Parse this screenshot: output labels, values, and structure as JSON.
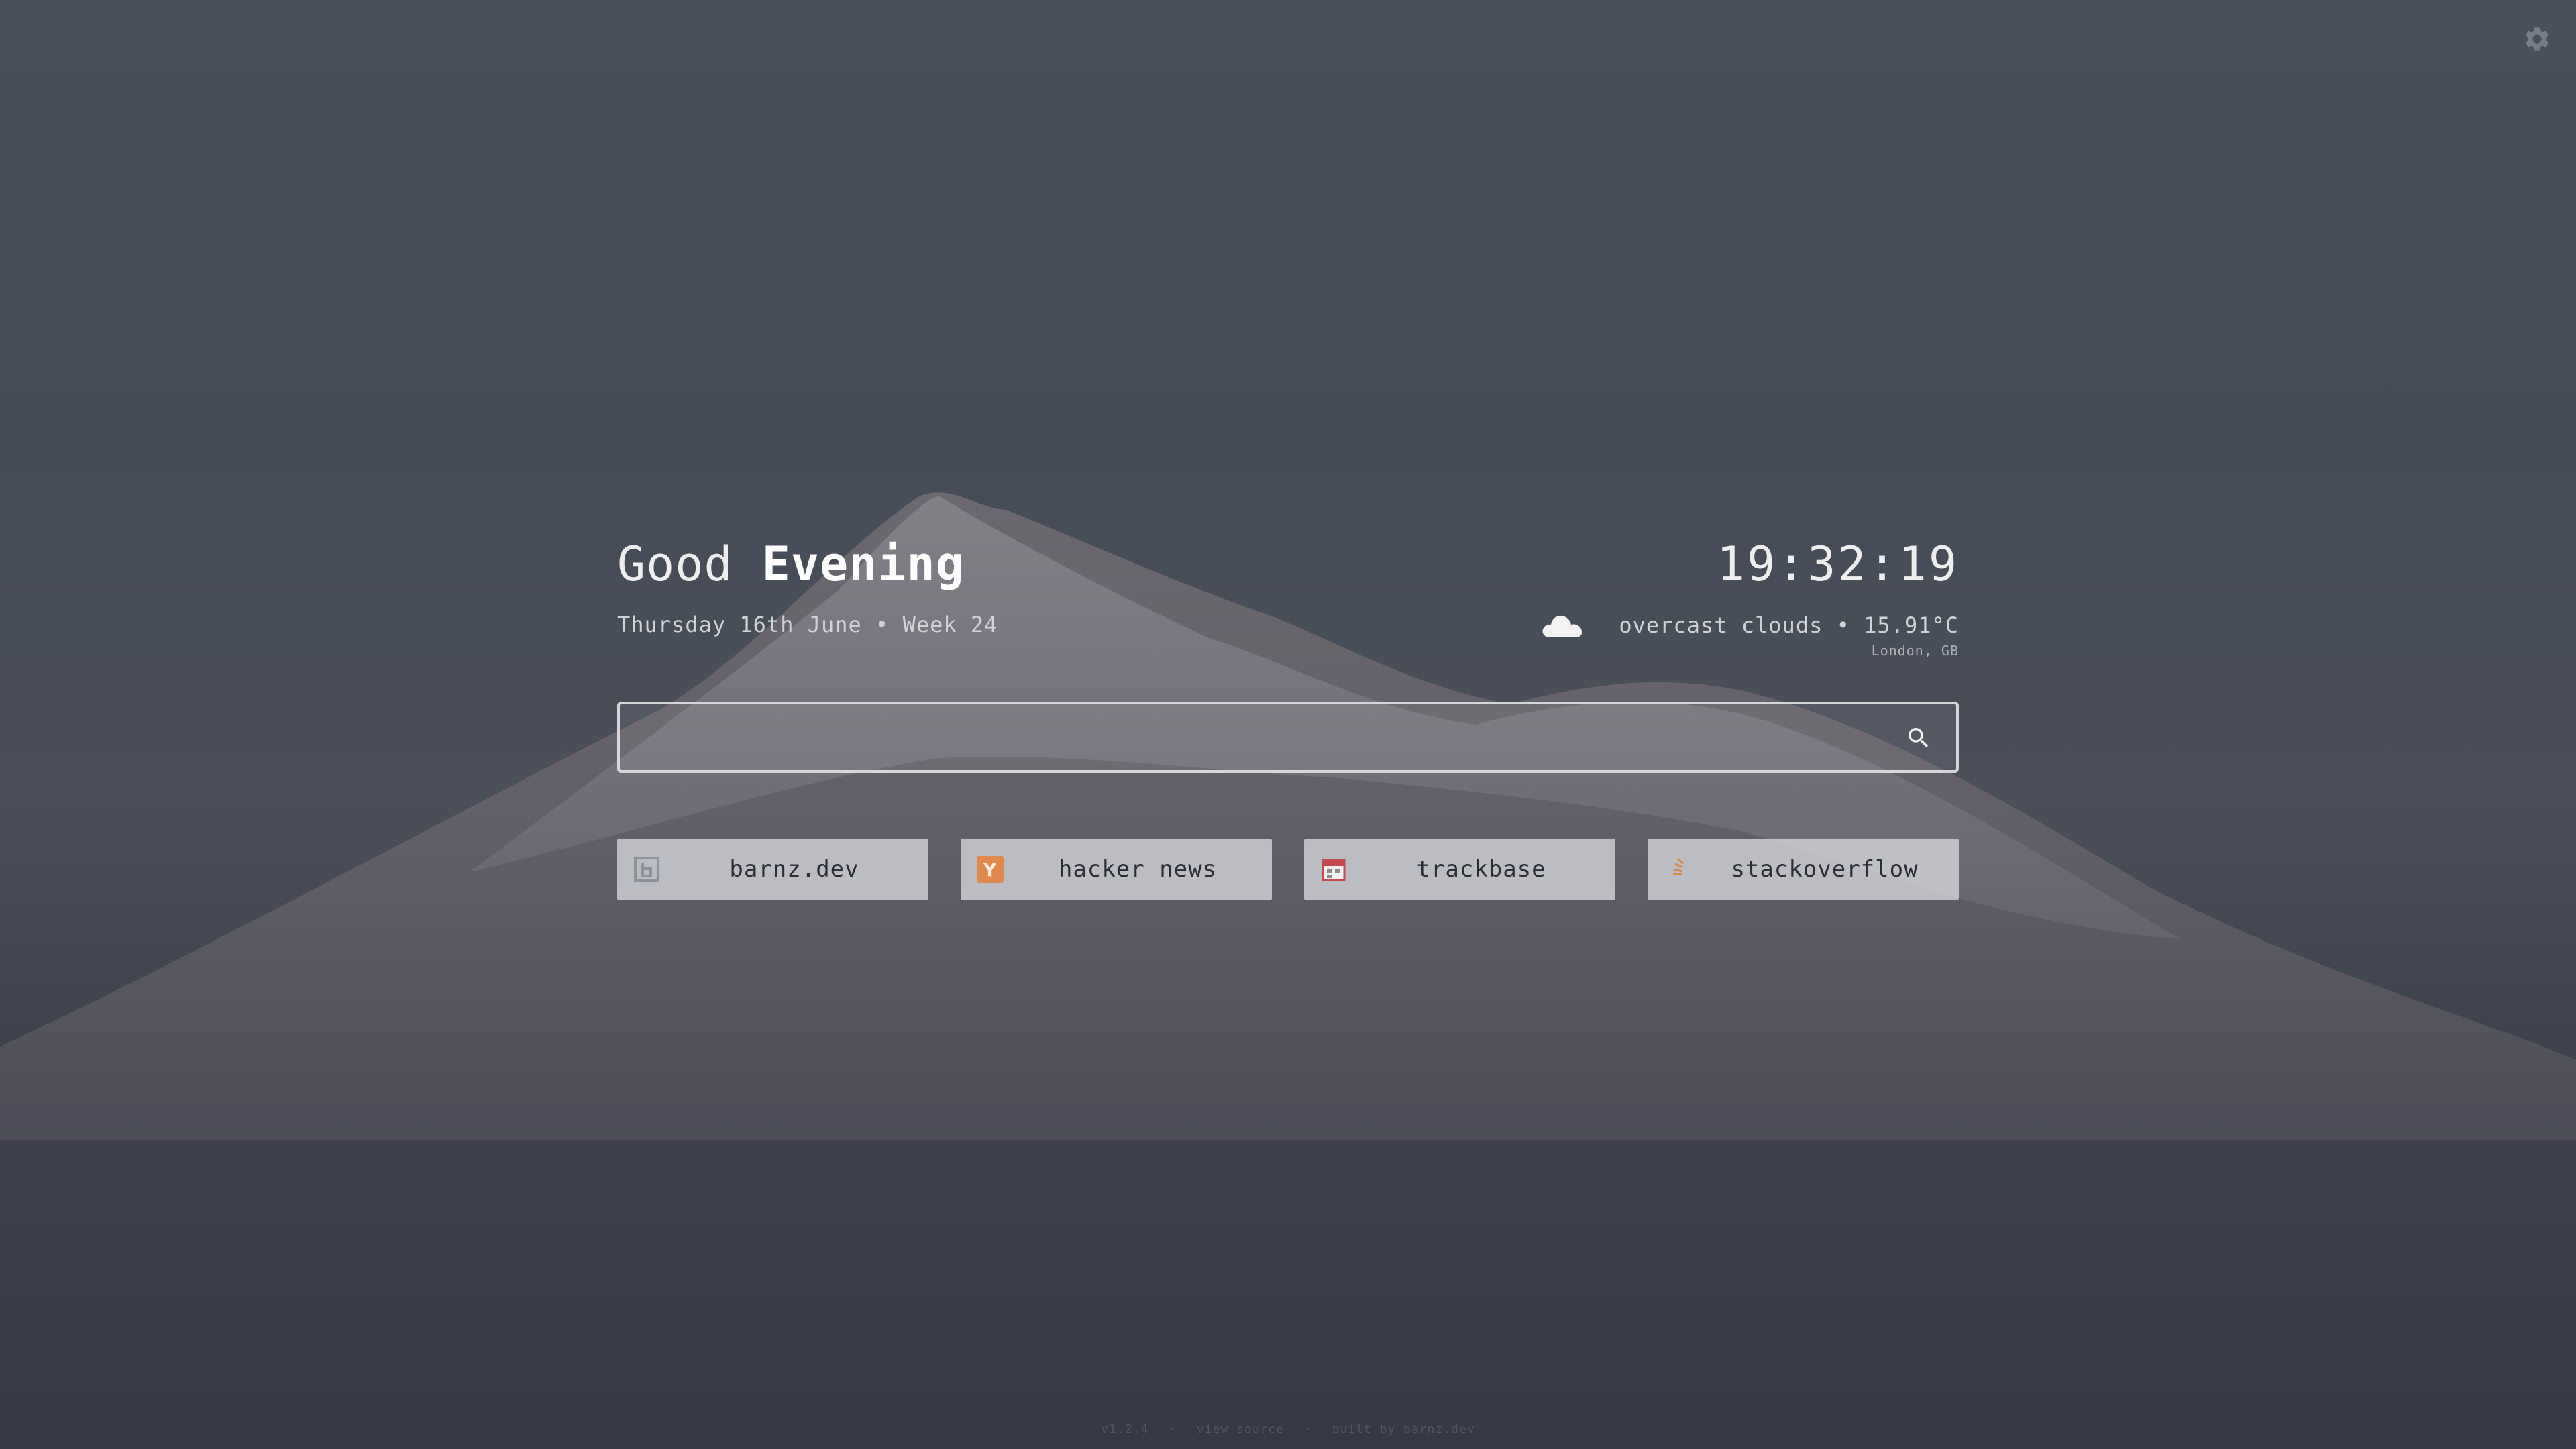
{
  "greeting": {
    "prefix": "Good",
    "period": "Evening"
  },
  "clock": {
    "time": "19:32:19"
  },
  "date": {
    "text": "Thursday 16th June • Week 24"
  },
  "weather": {
    "icon": "cloud-icon",
    "description": "overcast clouds • 15.91°C",
    "location": "London, GB"
  },
  "search": {
    "placeholder": "",
    "value": "",
    "icon": "search-icon"
  },
  "links": [
    {
      "label": "barnz.dev",
      "icon": "barnz-favicon",
      "color": "#8e939b"
    },
    {
      "label": "hacker news",
      "icon": "hacker-news-favicon",
      "color": "#e0884e"
    },
    {
      "label": "trackbase",
      "icon": "trackbase-favicon",
      "color": "#c7494f"
    },
    {
      "label": "stackoverflow",
      "icon": "stackoverflow-favicon",
      "color": "#d7883e"
    }
  ],
  "footer": {
    "version": "v1.2.4",
    "source_label": "view source",
    "built_by": "built by",
    "author": "barnz.dev"
  },
  "settings": {
    "icon": "gear-icon"
  },
  "colors": {
    "text": "#eeeeee",
    "link_bg": "#d6d8dc",
    "hn_orange": "#e0884e"
  }
}
